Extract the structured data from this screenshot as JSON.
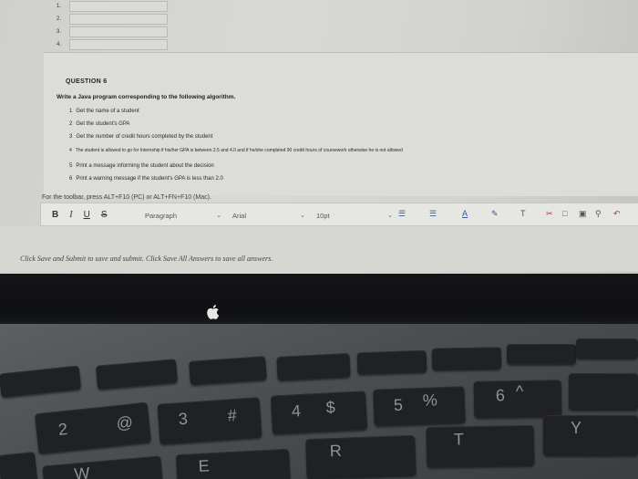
{
  "answer_rows": [
    "1.",
    "2.",
    "3.",
    "4."
  ],
  "question": {
    "title": "QUESTION 6",
    "intro": "Write a Java program corresponding to the following algorithm.",
    "steps": [
      {
        "n": "1",
        "text": "Get the name of a student"
      },
      {
        "n": "2",
        "text": "Get the student's GPA"
      },
      {
        "n": "3",
        "text": "Get the number of credit hours completed by the student"
      },
      {
        "n": "4",
        "text": "The student is allowed to go for Internship if his/her GPA is between 2.5 and 4.0 and if he/she completed 90 credit hours of coursework otherwise he is not allowed"
      },
      {
        "n": "5",
        "text": "Print a message informing the student about the decision"
      },
      {
        "n": "6",
        "text": "Print a warning message if the student's GPA is less than 2.0"
      }
    ]
  },
  "toolbar": {
    "hint": "For the toolbar, press ALT+F10 (PC) or ALT+FN+F10 (Mac).",
    "bold": "B",
    "italic": "I",
    "underline": "U",
    "strike": "S",
    "paragraph": "Paragraph",
    "font": "Arial",
    "size": "10pt"
  },
  "save_note": "Click Save and Submit to save and submit. Click Save All Answers to save all answers.",
  "keys": {
    "row1": [
      "!",
      "@",
      "#",
      "$",
      "%",
      "^"
    ],
    "row2": [
      "2",
      "3",
      "4",
      "5",
      "6"
    ],
    "row3": [
      "W",
      "E",
      "R",
      "T",
      "Y"
    ]
  }
}
